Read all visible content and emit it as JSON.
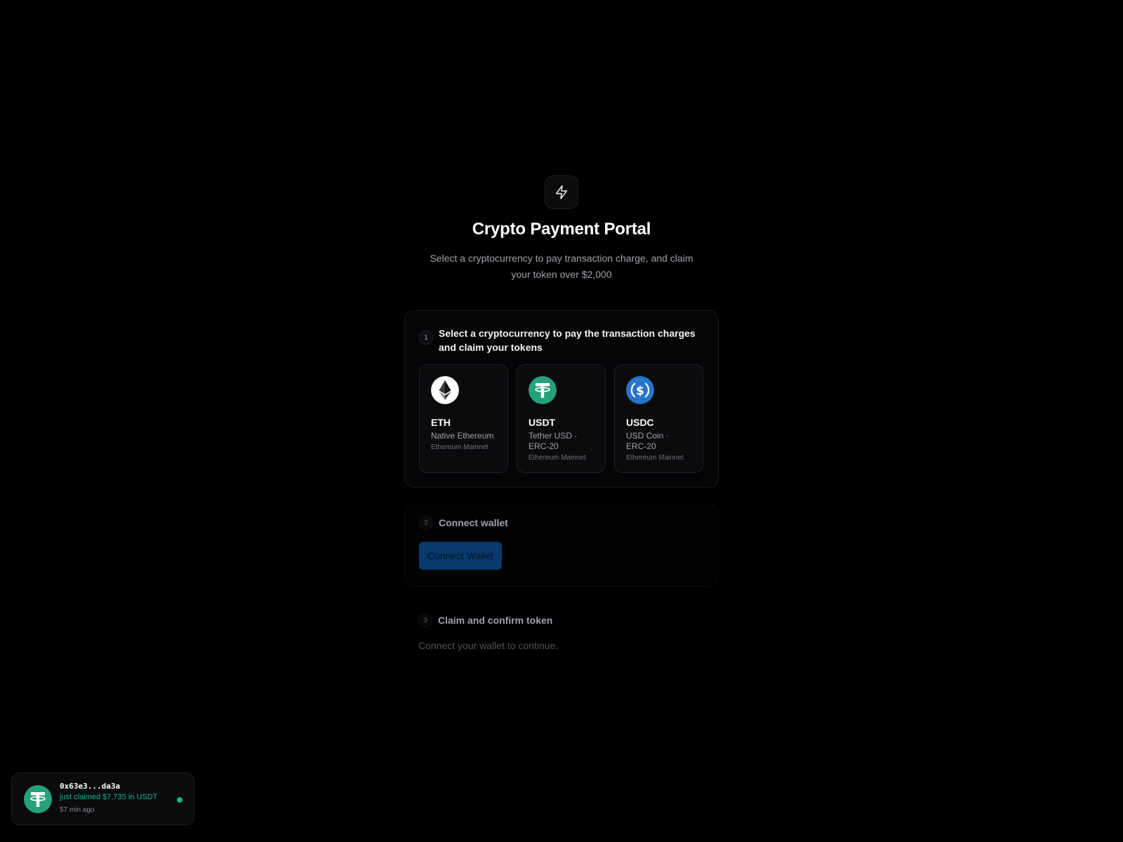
{
  "header": {
    "title": "Crypto Payment Portal",
    "subtitle": "Select a cryptocurrency to pay transaction charge, and claim your token over $2,000",
    "logo_icon": "lightning-bolt-icon"
  },
  "step1": {
    "number": "1",
    "title": "Select a cryptocurrency to pay the transaction charges and claim your tokens",
    "tokens": [
      {
        "symbol": "ETH",
        "name": "Native Ethereum",
        "network": "Ethereum Mainnet",
        "icon": "ethereum-icon",
        "color": "#ffffff"
      },
      {
        "symbol": "USDT",
        "name": "Tether USD · ERC-20",
        "network": "Ethereum Mainnet",
        "icon": "tether-icon",
        "color": "#26a17b"
      },
      {
        "symbol": "USDC",
        "name": "USD Coin · ERC-20",
        "network": "Ethereum Mainnet",
        "icon": "usdc-icon",
        "color": "#2775ca"
      }
    ]
  },
  "step2": {
    "number": "2",
    "title": "Connect wallet",
    "button_label": "Connect Wallet"
  },
  "step3": {
    "number": "3",
    "title": "Claim and confirm token",
    "hint": "Connect your wallet to continue."
  },
  "toast": {
    "address": "0x63e3...da3a",
    "message": "just claimed $7,735 in USDT",
    "time": "57 min ago",
    "icon": "tether-icon",
    "accent": "#10b981"
  },
  "colors": {
    "background": "#000000",
    "accent_blue": "#083a6b",
    "success_green": "#10b981"
  }
}
